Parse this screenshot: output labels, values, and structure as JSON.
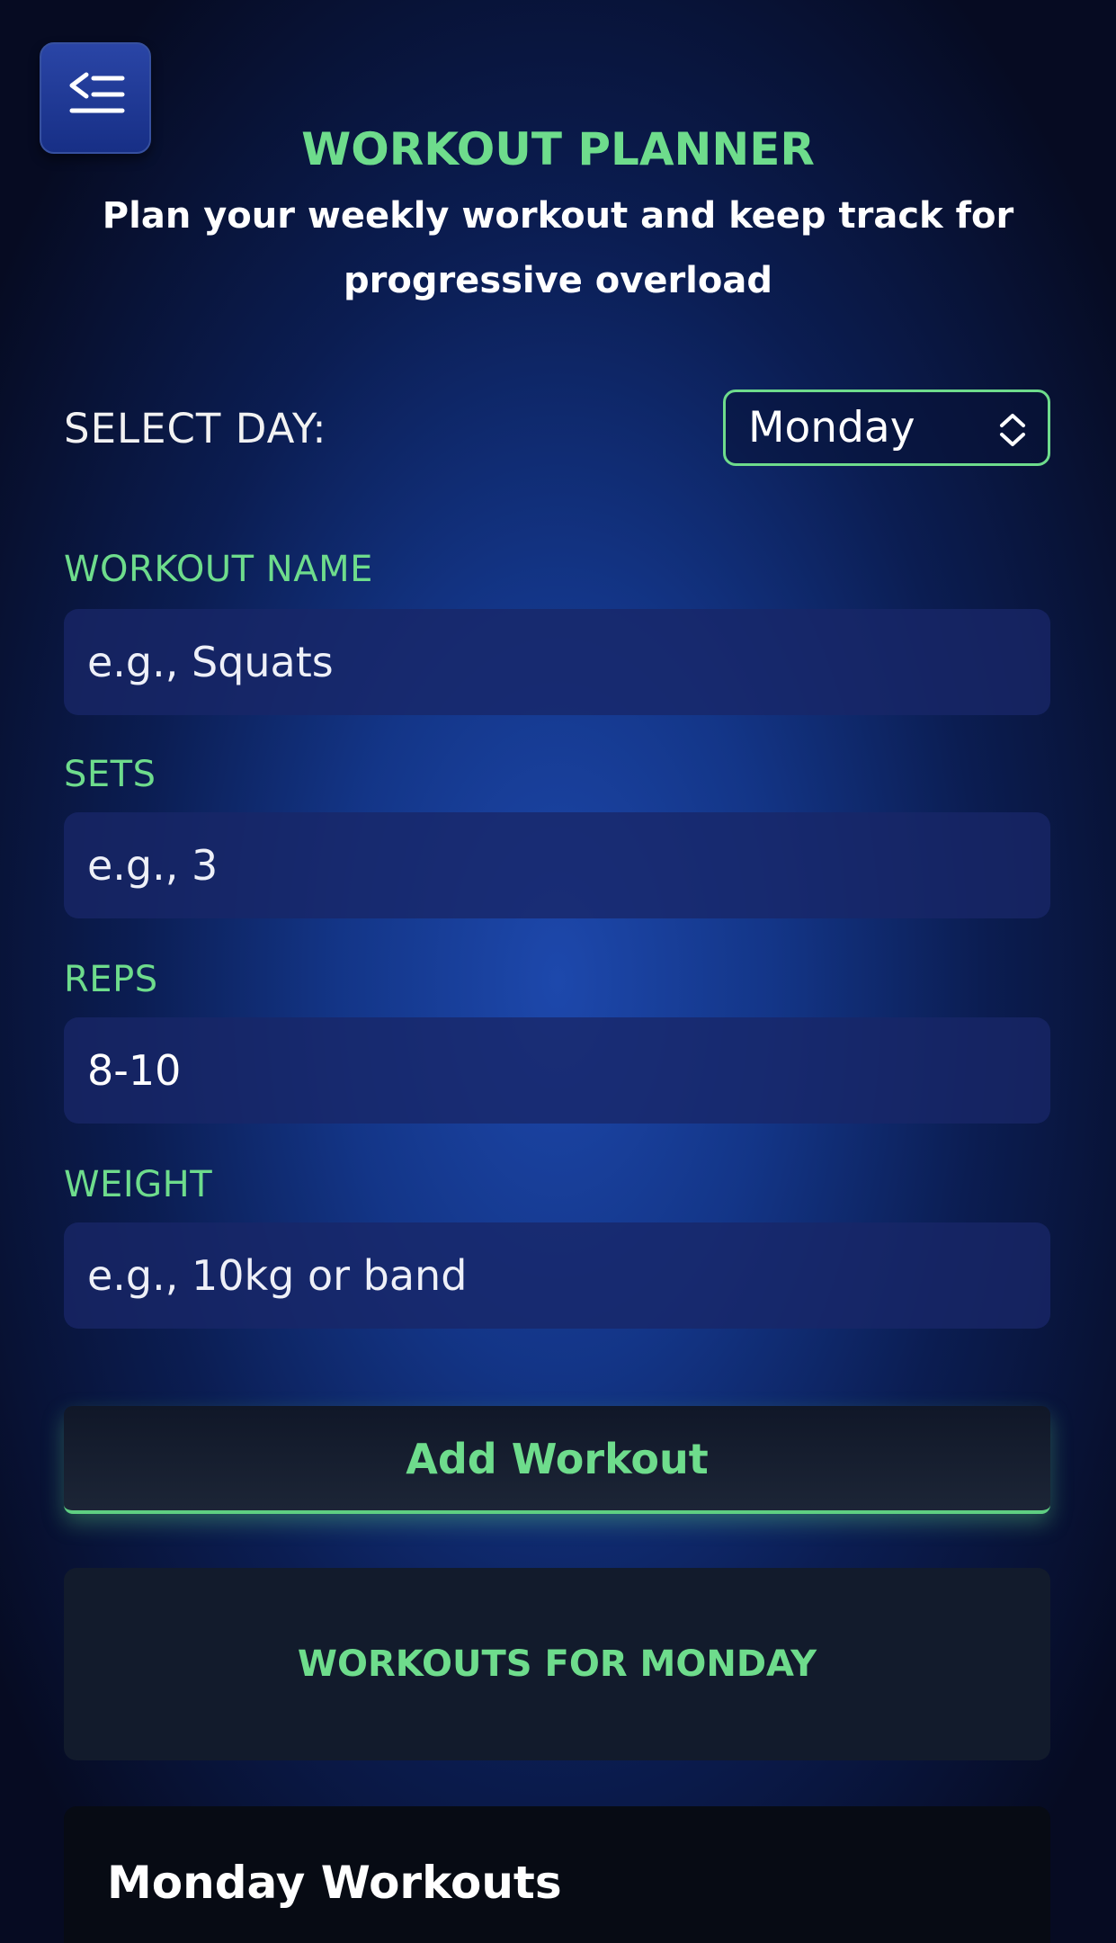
{
  "header": {
    "menu_icon": "sidebar-collapse-icon",
    "title": "WORKOUT PLANNER",
    "subtitle": "Plan your weekly workout and keep track for progressive overload"
  },
  "day_selector": {
    "label": "SELECT DAY:",
    "selected": "Monday",
    "icon": "chevron-up-down-icon"
  },
  "form": {
    "workout_name": {
      "label": "WORKOUT NAME",
      "placeholder": "e.g., Squats",
      "value": ""
    },
    "sets": {
      "label": "SETS",
      "placeholder": "e.g., 3",
      "value": ""
    },
    "reps": {
      "label": "REPS",
      "placeholder": "",
      "value": "8-10"
    },
    "weight": {
      "label": "WEIGHT",
      "placeholder": "e.g., 10kg or band",
      "value": ""
    }
  },
  "actions": {
    "add_label": "Add Workout"
  },
  "workouts_section": {
    "heading": "WORKOUTS FOR MONDAY"
  },
  "workout_list": {
    "heading": "Monday Workouts"
  },
  "colors": {
    "accent": "#6edc8c",
    "background": "#133587",
    "input_background": "#18266a",
    "button_background": "#141c2e"
  }
}
